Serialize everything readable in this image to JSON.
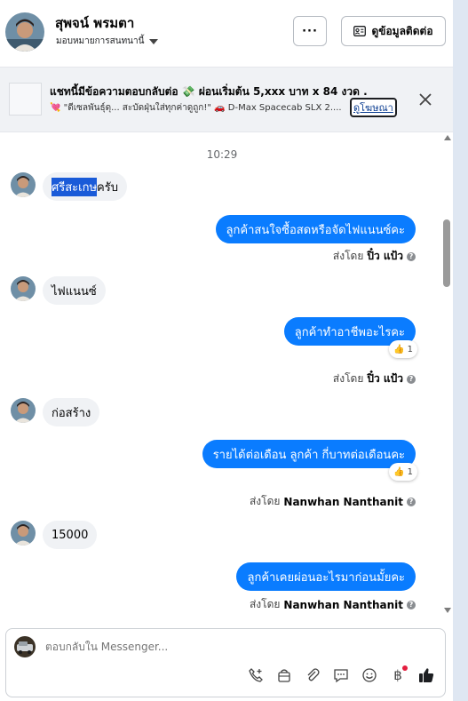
{
  "header": {
    "contact_name": "สุพจน์ พรมตา",
    "assign_label": "มอบหมายการสนทนานี้",
    "more_label": "···",
    "contact_info_label": "ดูข้อมูลติดต่อ"
  },
  "ad": {
    "title": "แชทนี้มีข้อความตอบกลับต่อ 💸 ผ่อนเริ่มต้น 5,xxx บาท x 84 งวด .",
    "subtitle": "💘 \"ดีเซลพันธุ์ดุ... สะบัดฝุ่นใส่ทุกค่าดูถูก!\" 🚗 D-Max Spacecab SLX 2....",
    "link_label": "ดูโฆษณา"
  },
  "chat": {
    "timestamp": "10:29",
    "messages": [
      {
        "highlight": "ศรีสะเกษ",
        "text": "ครับ"
      },
      {
        "text": "ลูกค้าสนใจซื้อสดหรือจัดไฟแนนซ์คะ"
      },
      {
        "sender_prefix": "ส่งโดย",
        "sender": "ปิ๋ว แป้ว"
      },
      {
        "text": "ไฟแนนซ์"
      },
      {
        "text": "ลูกค้าทำอาชีพอะไรคะ",
        "reaction": "1"
      },
      {
        "sender_prefix": "ส่งโดย",
        "sender": "ปิ๋ว แป้ว"
      },
      {
        "text": "ก่อสร้าง"
      },
      {
        "text": "รายได้ต่อเดือน ลูกค้า กี่บาทต่อเดือนคะ",
        "reaction": "1"
      },
      {
        "sender_prefix": "ส่งโดย",
        "sender": "Nanwhan Nanthanit"
      },
      {
        "text": "15000"
      },
      {
        "text": "ลูกค้าเคยผ่อนอะไรมาก่อนมั้ยคะ"
      },
      {
        "sender_prefix": "ส่งโดย",
        "sender": "Nanwhan Nanthanit"
      }
    ]
  },
  "composer": {
    "placeholder": "ตอบกลับใน Messenger...",
    "tools": [
      "phone-plus-icon",
      "bag-icon",
      "paperclip-icon",
      "chat-bubble-icon",
      "smile-icon",
      "baht-icon",
      "thumbs-up-icon"
    ]
  },
  "colors": {
    "outgoing_bubble": "#0a7cff",
    "incoming_bubble": "#f0f2f5",
    "highlight": "#1a5bd8",
    "side_strip": "#dfe7f2"
  }
}
